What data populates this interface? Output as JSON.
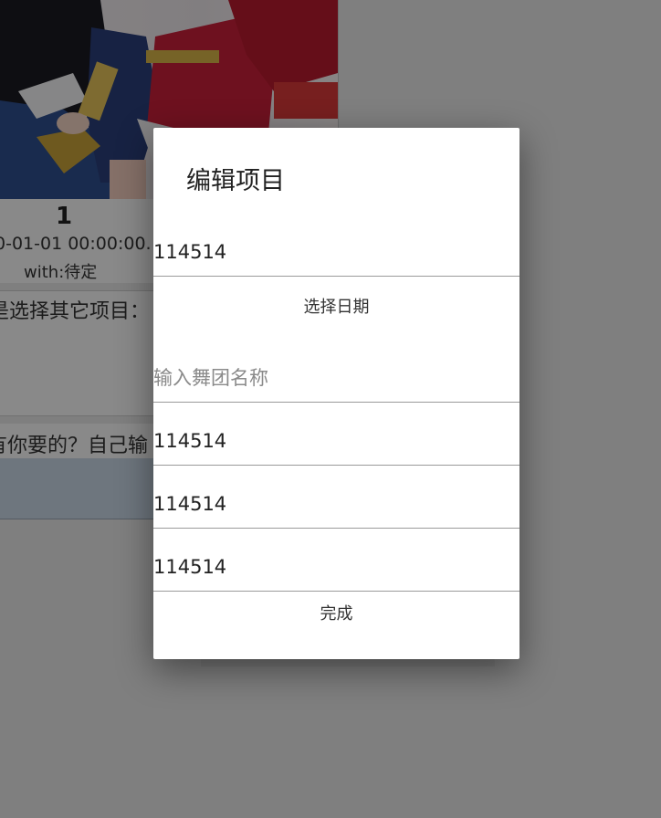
{
  "background": {
    "card_title": "1",
    "card_date": "0-01-01 00:00:00.",
    "card_with": "with:待定",
    "prompt_text": "是选择其它项目：",
    "prompt_text_2": "有你要的？自己输"
  },
  "dialog": {
    "title": "编辑项目",
    "field_1_value": "114514",
    "date_button_label": "选择日期",
    "troupe_placeholder": "输入舞团名称",
    "field_3_value": "114514",
    "field_4_value": "114514",
    "field_5_value": "114514",
    "done_label": "完成"
  },
  "colors": {
    "scrim": "#000000",
    "dialog_bg": "#ffffff",
    "underline": "#9a9a9a",
    "background_button": "#c9d7e6"
  }
}
